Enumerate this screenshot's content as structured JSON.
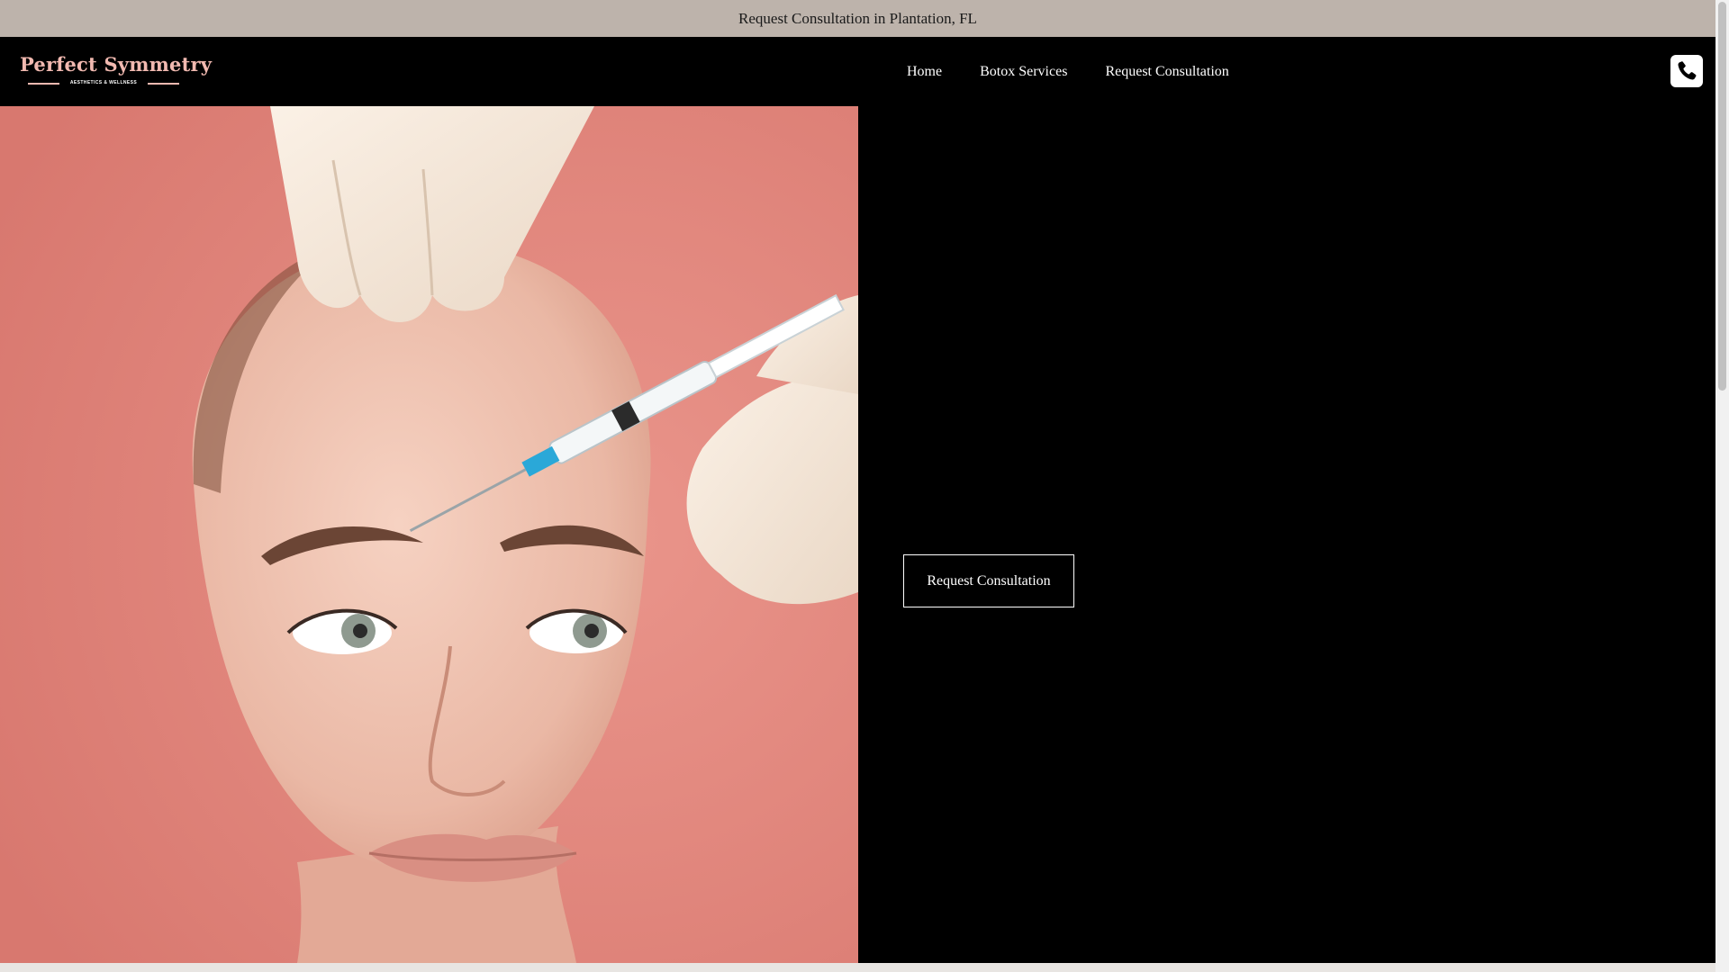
{
  "announcement": {
    "text": "Request Consultation in Plantation, FL"
  },
  "logo": {
    "title": "Perfect Symmetry",
    "tagline": "AESTHETICS & WELLNESS",
    "color": "#f1b9b0"
  },
  "nav": {
    "items": [
      {
        "label": "Home"
      },
      {
        "label": "Botox Services"
      },
      {
        "label": "Request Consultation"
      }
    ]
  },
  "phone": {
    "icon": "phone-icon"
  },
  "hero": {
    "image_subject": "woman-receiving-forehead-injection",
    "background_color": "#e0857c",
    "cta_label": "Request Consultation"
  },
  "colors": {
    "announce_bg": "#bdb3ab",
    "header_bg": "#000000",
    "accent": "#f1b9b0"
  }
}
